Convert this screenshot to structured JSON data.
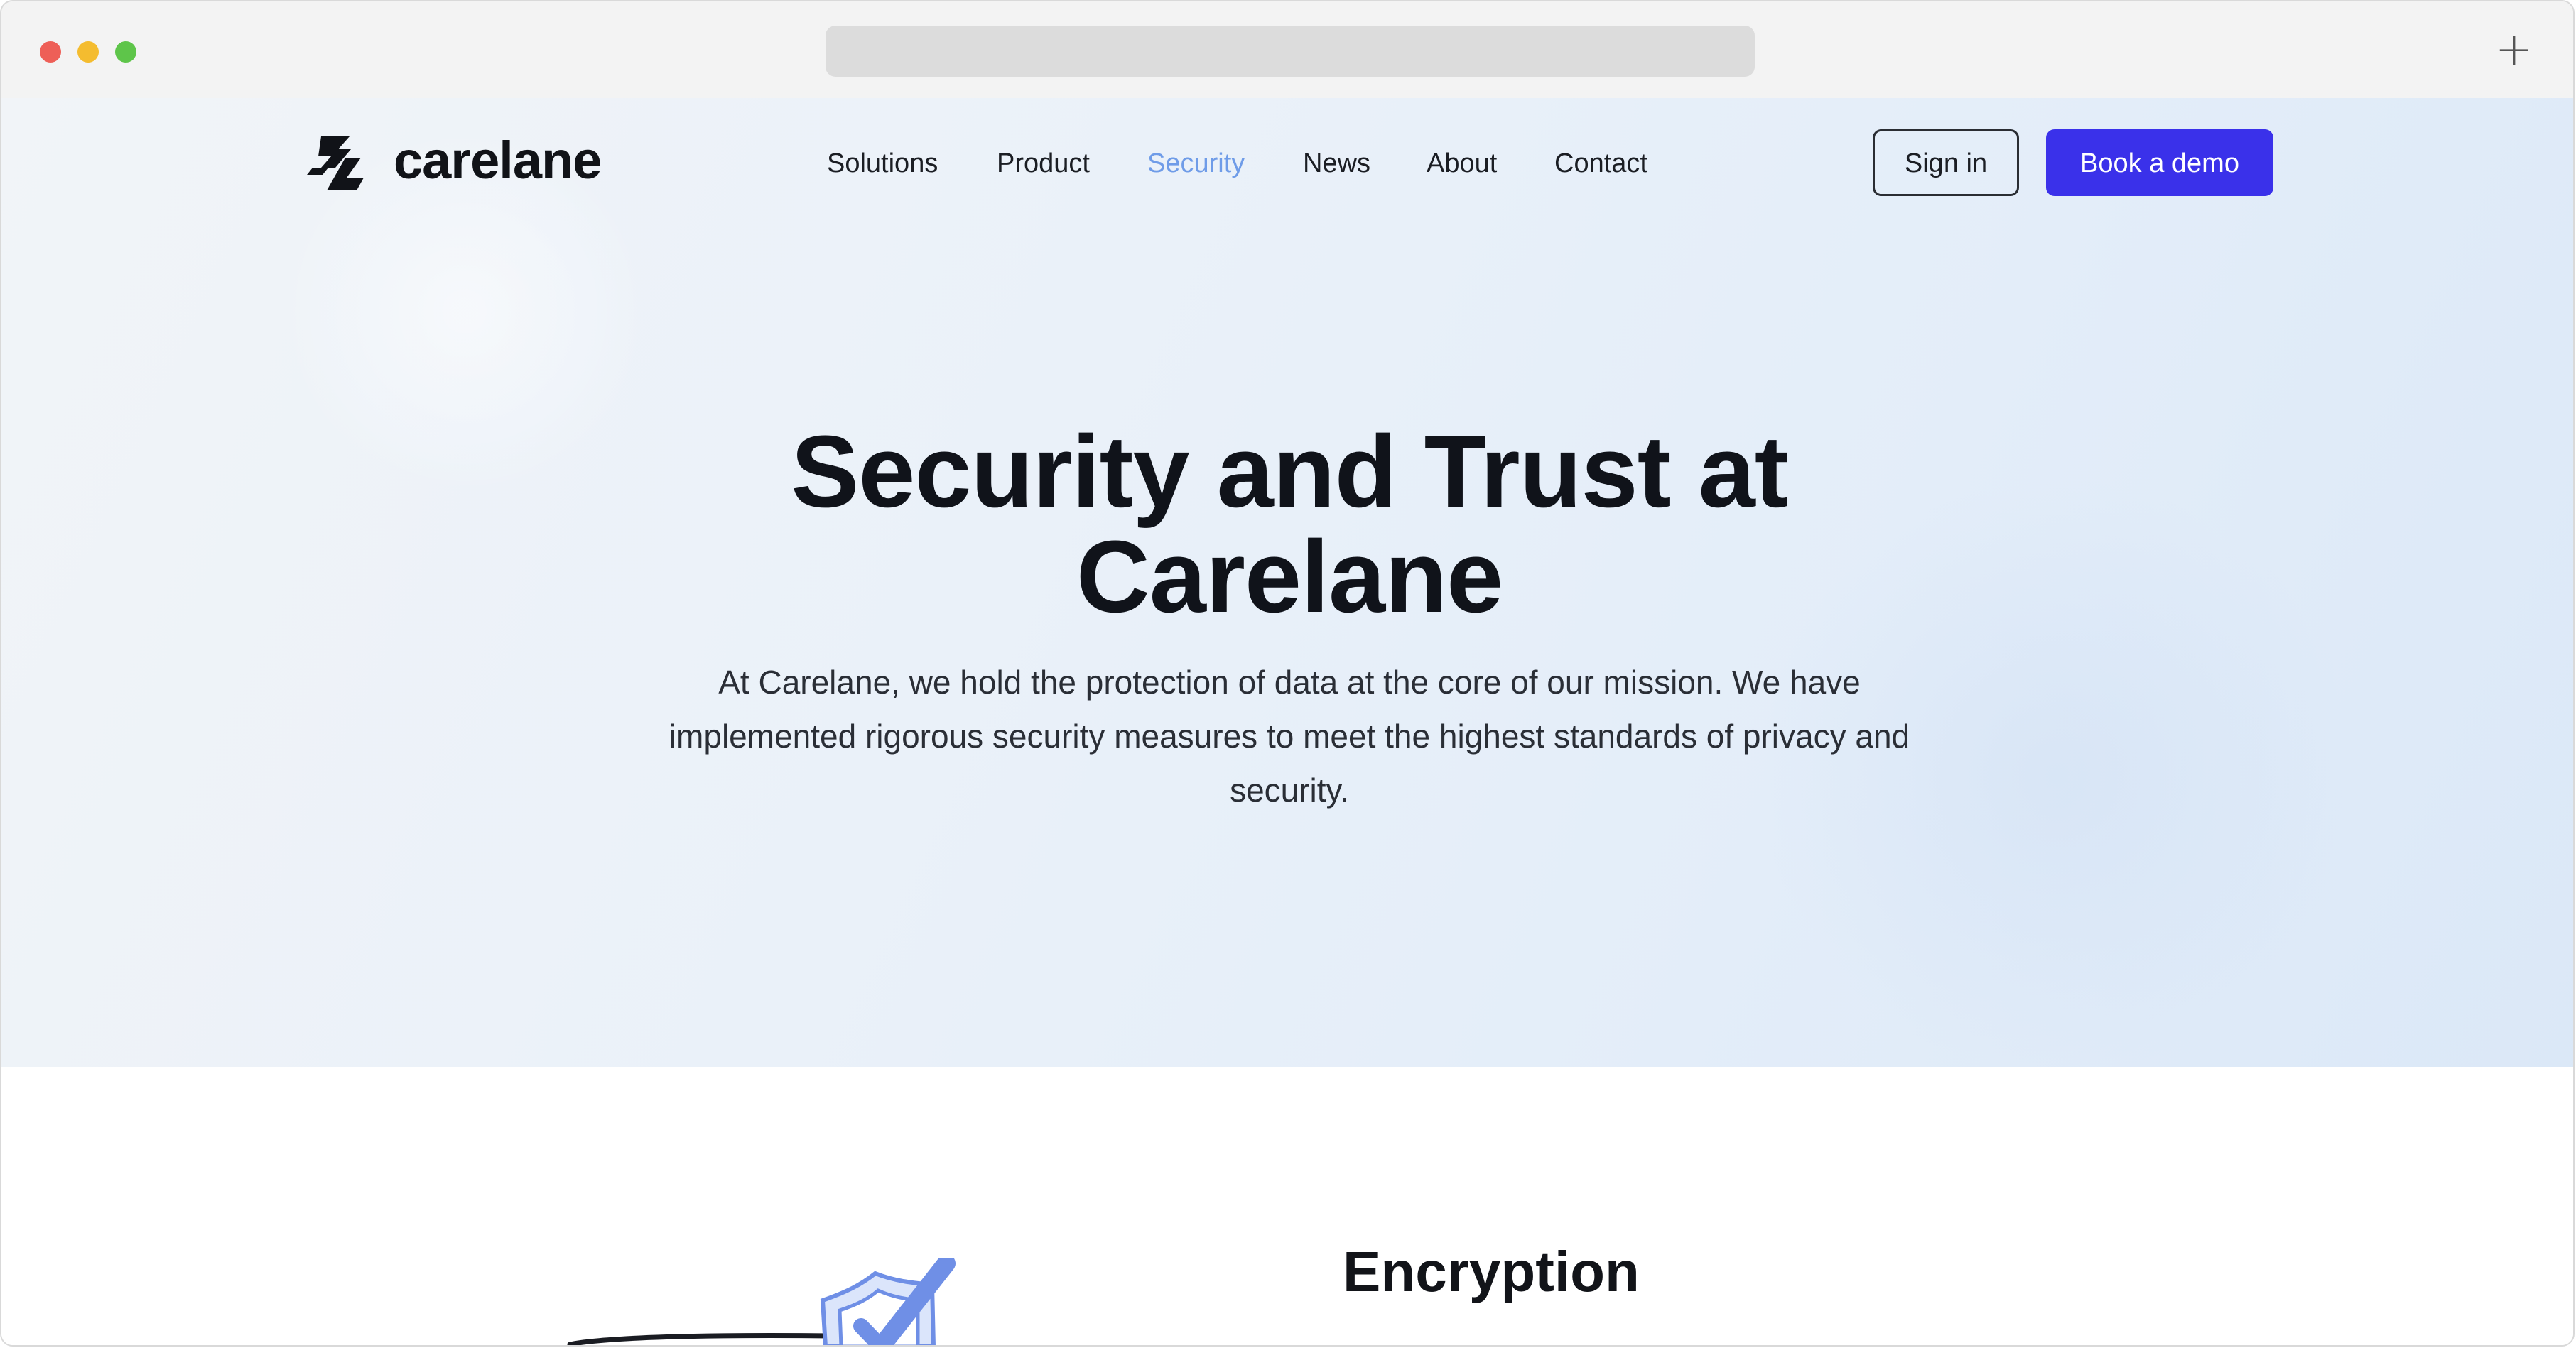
{
  "browser": {
    "new_tab_glyph": "+"
  },
  "brand": {
    "name": "carelane",
    "logo_icon": "carelane-logo-mark"
  },
  "nav": {
    "items": [
      {
        "label": "Solutions",
        "active": false
      },
      {
        "label": "Product",
        "active": false
      },
      {
        "label": "Security",
        "active": true
      },
      {
        "label": "News",
        "active": false
      },
      {
        "label": "About",
        "active": false
      },
      {
        "label": "Contact",
        "active": false
      }
    ],
    "signin_label": "Sign in",
    "demo_label": "Book a demo"
  },
  "hero": {
    "title_line1": "Security and Trust at",
    "title_line2": "Carelane",
    "subtitle_line1": "At Carelane, we hold the protection of data at the core of our mission. We have",
    "subtitle_line2": "implemented rigorous security measures to meet the highest standards of privacy and",
    "subtitle_line3": "security."
  },
  "section": {
    "title": "Encryption",
    "illustration_icon": "shield-check-icon"
  },
  "colors": {
    "accent": "#3a31ea",
    "active_nav": "#6f9ce8",
    "text_dark": "#10131a"
  }
}
